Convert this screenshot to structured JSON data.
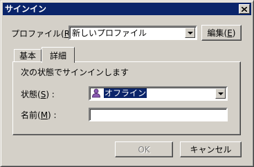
{
  "window": {
    "title": "サインイン"
  },
  "profile": {
    "label": "プロファイル(",
    "accel": "R",
    "label_end": "):",
    "value": "新しいプロファイル",
    "edit_label": "編集(",
    "edit_accel": "E",
    "edit_end": ")"
  },
  "tabs": [
    {
      "label": "基本"
    },
    {
      "label": "詳細"
    }
  ],
  "detail": {
    "heading": "次の状態でサインインします",
    "state_label": "状態(",
    "state_accel": "S",
    "state_end": ") :",
    "state_value": "オフライン",
    "name_label": "名前(",
    "name_accel": "M",
    "name_end": ") :",
    "name_value": ""
  },
  "buttons": {
    "ok": "OK",
    "cancel": "キャンセル"
  }
}
